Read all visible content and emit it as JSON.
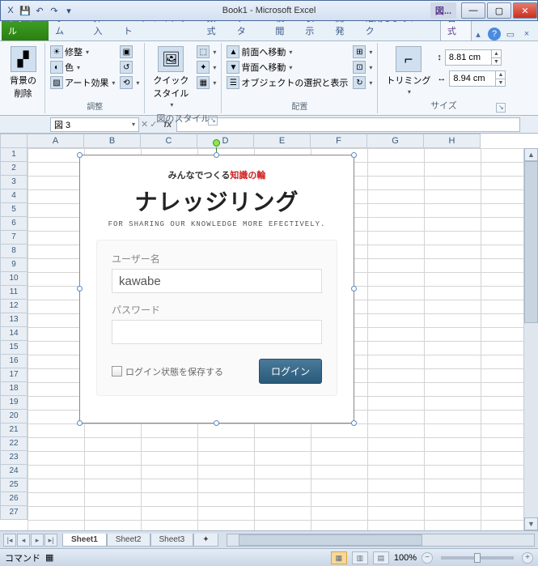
{
  "title": "Book1 - Microsoft Excel",
  "contextTab": "図...",
  "qat": {
    "excel": "X",
    "save": "💾",
    "undo": "↶",
    "redo": "↷",
    "more": "▾"
  },
  "tabs": {
    "file": "ファイル",
    "home": "ホーム",
    "insert": "挿入",
    "layout": "ページ レイアウト",
    "formulas": "数式",
    "data": "データ",
    "review": "校閲",
    "view": "表示",
    "dev": "開発",
    "use": "活用しよう！エク",
    "format": "書式"
  },
  "help": {
    "min": "▴",
    "help": "?",
    "rmin": "▭",
    "rclose": "×"
  },
  "ribbon": {
    "removeBg": "背景の\n削除",
    "corrections": "修整",
    "color": "色",
    "artEffects": "アート効果",
    "adjustGroup": "調整",
    "quickStyles": "クイック\nスタイル",
    "border": "⬚",
    "effects": "✦",
    "layoutPic": "▦",
    "stylesGroup": "図のスタイル",
    "bringForward": "前面へ移動",
    "sendBackward": "背面へ移動",
    "selectionPane": "オブジェクトの選択と表示",
    "align": "⊞",
    "group": "⊡",
    "rotate": "↻",
    "arrangeGroup": "配置",
    "crop": "トリミング",
    "height": "8.81 cm",
    "width": "8.94 cm",
    "heightIcon": "↕",
    "widthIcon": "↔",
    "sizeGroup": "サイズ"
  },
  "nameBox": "図 3",
  "fxLabel": "fx",
  "cols": [
    "A",
    "B",
    "C",
    "D",
    "E",
    "F",
    "G",
    "H"
  ],
  "rows": [
    "1",
    "2",
    "3",
    "4",
    "5",
    "6",
    "7",
    "8",
    "9",
    "10",
    "11",
    "12",
    "13",
    "14",
    "15",
    "16",
    "17",
    "18",
    "19",
    "20",
    "21",
    "22",
    "23",
    "24",
    "25",
    "26",
    "27"
  ],
  "login": {
    "tag1": "みんなでつくる",
    "tag2": "知識の輪",
    "brand": "ナレッジリング",
    "sub": "FOR SHARING OUR KNOWLEDGE MORE EFECTIVELY.",
    "userLabel": "ユーザー名",
    "userValue": "kawabe",
    "passLabel": "パスワード",
    "passValue": "",
    "remember": "ログイン状態を保存する",
    "button": "ログイン"
  },
  "sheets": {
    "s1": "Sheet1",
    "s2": "Sheet2",
    "s3": "Sheet3",
    "new": "✦"
  },
  "status": {
    "mode": "コマンド",
    "macro": "▦",
    "zoom": "100%"
  }
}
